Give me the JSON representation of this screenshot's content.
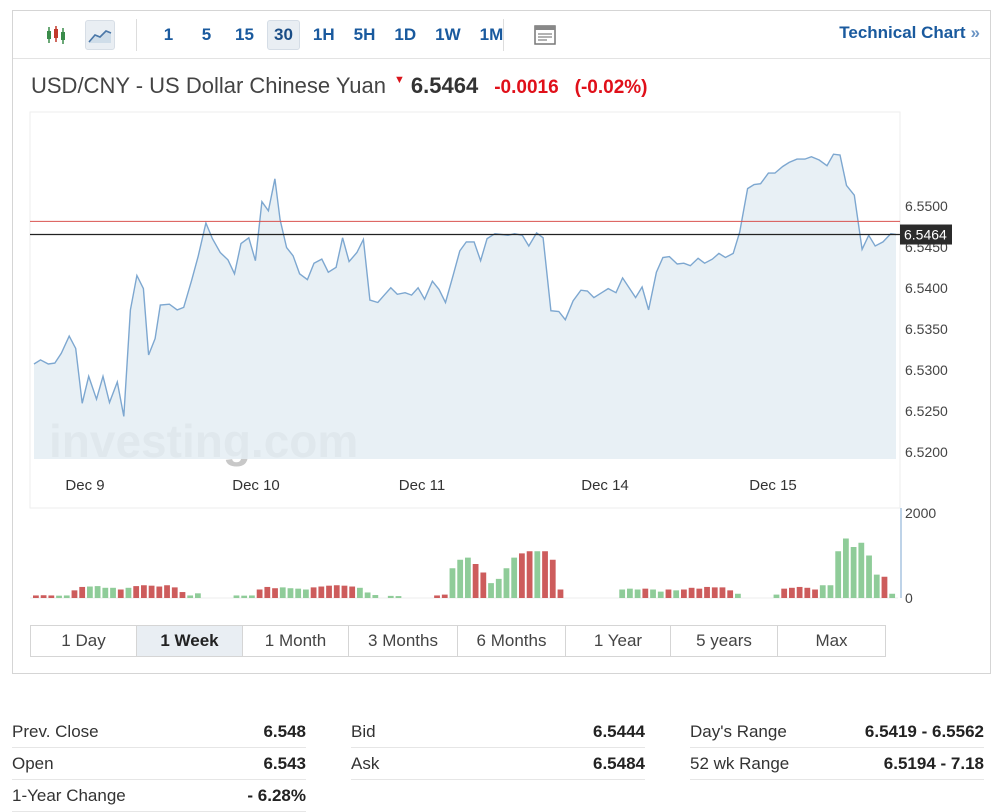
{
  "toolbar": {
    "intervals": [
      {
        "label": "1",
        "active": false
      },
      {
        "label": "5",
        "active": false
      },
      {
        "label": "15",
        "active": false
      },
      {
        "label": "30",
        "active": true
      },
      {
        "label": "1H",
        "active": false
      },
      {
        "label": "5H",
        "active": false
      },
      {
        "label": "1D",
        "active": false
      },
      {
        "label": "1W",
        "active": false
      },
      {
        "label": "1M",
        "active": false
      }
    ],
    "technical_chart_label": "Technical Chart",
    "technical_chart_arrows": "»"
  },
  "header": {
    "name": "USD/CNY - US Dollar Chinese Yuan",
    "price": "6.5464",
    "change": "-0.0016",
    "change_pct": "(-0.02%)"
  },
  "colors": {
    "line": "#7da7d0",
    "area": "#e4edf3",
    "up_bar": "#8fcc99",
    "down_bar": "#cd5c5c",
    "reference_line": "#d9534f",
    "current_line": "#222222",
    "down": "#e0101a",
    "link": "#1a5a9e"
  },
  "watermark": "investing.com",
  "chart_data": {
    "type": "area",
    "ylim": [
      6.519,
      6.5605
    ],
    "y_ticks": [
      "6.5500",
      "6.5450",
      "6.5400",
      "6.5350",
      "6.5300",
      "6.5250",
      "6.5200"
    ],
    "x_labels": [
      "Dec 9",
      "Dec 10",
      "Dec 11",
      "Dec 14",
      "Dec 15"
    ],
    "reference_value": 6.548,
    "current_value": 6.5464,
    "current_label": "6.5464",
    "price_series": [
      [
        0,
        6.5306
      ],
      [
        0.5,
        6.5311
      ],
      [
        1.1,
        6.5306
      ],
      [
        1.6,
        6.5307
      ],
      [
        2.1,
        6.5319
      ],
      [
        2.7,
        6.534
      ],
      [
        3.2,
        6.5325
      ],
      [
        3.7,
        6.5258
      ],
      [
        4.2,
        6.5291
      ],
      [
        4.8,
        6.5263
      ],
      [
        5.3,
        6.5291
      ],
      [
        5.8,
        6.5259
      ],
      [
        6.4,
        6.5284
      ],
      [
        6.9,
        6.5242
      ],
      [
        7.4,
        6.5372
      ],
      [
        7.9,
        6.5414
      ],
      [
        8.4,
        6.5398
      ],
      [
        8.8,
        6.5317
      ],
      [
        9.3,
        6.5337
      ],
      [
        9.7,
        6.5378
      ],
      [
        10.4,
        6.5379
      ],
      [
        11,
        6.5372
      ],
      [
        11.5,
        6.5375
      ],
      [
        12.1,
        6.5408
      ],
      [
        12.6,
        6.5437
      ],
      [
        13.2,
        6.5478
      ],
      [
        13.7,
        6.5459
      ],
      [
        14.3,
        6.5442
      ],
      [
        14.9,
        6.5433
      ],
      [
        15.4,
        6.5416
      ],
      [
        15.9,
        6.5453
      ],
      [
        16.5,
        6.546
      ],
      [
        17,
        6.5432
      ],
      [
        17.5,
        6.5504
      ],
      [
        18,
        6.5493
      ],
      [
        18.5,
        6.5532
      ],
      [
        18.9,
        6.5482
      ],
      [
        19.4,
        6.5448
      ],
      [
        19.9,
        6.5438
      ],
      [
        20.4,
        6.5416
      ],
      [
        21,
        6.5409
      ],
      [
        21.5,
        6.5429
      ],
      [
        22.1,
        6.5434
      ],
      [
        22.6,
        6.5418
      ],
      [
        23.2,
        6.5424
      ],
      [
        23.7,
        6.546
      ],
      [
        24.2,
        6.5431
      ],
      [
        24.8,
        6.5442
      ],
      [
        25.3,
        6.5458
      ],
      [
        25.8,
        6.5384
      ],
      [
        26.4,
        6.5381
      ],
      [
        26.9,
        6.539
      ],
      [
        27.4,
        6.5399
      ],
      [
        27.9,
        6.5391
      ],
      [
        28.5,
        6.5393
      ],
      [
        29,
        6.539
      ],
      [
        29.5,
        6.5399
      ],
      [
        30,
        6.5385
      ],
      [
        30.6,
        6.5407
      ],
      [
        31.1,
        6.5397
      ],
      [
        31.6,
        6.5381
      ],
      [
        32.2,
        6.5415
      ],
      [
        32.7,
        6.5444
      ],
      [
        33.2,
        6.5455
      ],
      [
        33.8,
        6.5455
      ],
      [
        34.3,
        6.5432
      ],
      [
        34.8,
        6.5459
      ],
      [
        35.4,
        6.5465
      ],
      [
        35.9,
        6.5464
      ],
      [
        36.4,
        6.5463
      ],
      [
        36.9,
        6.5465
      ],
      [
        37.5,
        6.5463
      ],
      [
        38,
        6.545
      ],
      [
        38.6,
        6.5466
      ],
      [
        39.1,
        6.546
      ],
      [
        39.7,
        6.5371
      ],
      [
        40.3,
        6.537
      ],
      [
        40.8,
        6.536
      ],
      [
        41.4,
        6.5383
      ],
      [
        42,
        6.5396
      ],
      [
        42.5,
        6.5395
      ],
      [
        43,
        6.5387
      ],
      [
        43.6,
        6.5393
      ],
      [
        44.1,
        6.5398
      ],
      [
        44.7,
        6.5393
      ],
      [
        45.2,
        6.5411
      ],
      [
        45.7,
        6.5399
      ],
      [
        46.2,
        6.5387
      ],
      [
        46.7,
        6.54
      ],
      [
        47.2,
        6.5372
      ],
      [
        47.8,
        6.5418
      ],
      [
        48.3,
        6.5436
      ],
      [
        48.8,
        6.5437
      ],
      [
        49.4,
        6.5428
      ],
      [
        49.9,
        6.5429
      ],
      [
        50.4,
        6.5426
      ],
      [
        51,
        6.5435
      ],
      [
        51.5,
        6.5429
      ],
      [
        52.1,
        6.5434
      ],
      [
        52.6,
        6.5441
      ],
      [
        53.1,
        6.5436
      ],
      [
        53.7,
        6.5441
      ],
      [
        54.2,
        6.5467
      ],
      [
        54.8,
        6.552
      ],
      [
        55.3,
        6.5525
      ],
      [
        55.8,
        6.5526
      ],
      [
        56.4,
        6.5539
      ],
      [
        56.9,
        6.5539
      ],
      [
        57.5,
        6.5547
      ],
      [
        58,
        6.5552
      ],
      [
        58.6,
        6.5556
      ],
      [
        59.2,
        6.5556
      ],
      [
        59.7,
        6.5559
      ],
      [
        60.3,
        6.5555
      ],
      [
        60.9,
        6.5548
      ],
      [
        61.4,
        6.5562
      ],
      [
        61.9,
        6.5561
      ],
      [
        62.4,
        6.5524
      ],
      [
        63,
        6.5512
      ],
      [
        63.6,
        6.5446
      ],
      [
        64.1,
        6.5463
      ],
      [
        64.6,
        6.545
      ],
      [
        65.2,
        6.5455
      ],
      [
        65.8,
        6.5465
      ],
      [
        66.2,
        6.5464
      ]
    ],
    "volume_axis": {
      "ylim": [
        0,
        2000
      ],
      "ticks": [
        "2000",
        "0"
      ]
    },
    "volume": [
      [
        0,
        60,
        0
      ],
      [
        1,
        65,
        0
      ],
      [
        2,
        60,
        0
      ],
      [
        3,
        55,
        1
      ],
      [
        4,
        60,
        1
      ],
      [
        5,
        180,
        0
      ],
      [
        6,
        260,
        0
      ],
      [
        7,
        270,
        1
      ],
      [
        8,
        280,
        1
      ],
      [
        9,
        240,
        1
      ],
      [
        10,
        240,
        1
      ],
      [
        11,
        200,
        0
      ],
      [
        12,
        240,
        1
      ],
      [
        13,
        280,
        0
      ],
      [
        14,
        300,
        0
      ],
      [
        15,
        290,
        0
      ],
      [
        16,
        270,
        0
      ],
      [
        17,
        300,
        0
      ],
      [
        18,
        250,
        0
      ],
      [
        19,
        140,
        0
      ],
      [
        20,
        60,
        1
      ],
      [
        21,
        110,
        1
      ],
      [
        26,
        60,
        1
      ],
      [
        27,
        55,
        1
      ],
      [
        28,
        60,
        1
      ],
      [
        29,
        200,
        0
      ],
      [
        30,
        260,
        0
      ],
      [
        31,
        230,
        0
      ],
      [
        32,
        250,
        1
      ],
      [
        33,
        230,
        1
      ],
      [
        34,
        220,
        1
      ],
      [
        35,
        200,
        1
      ],
      [
        36,
        250,
        0
      ],
      [
        37,
        270,
        0
      ],
      [
        38,
        290,
        0
      ],
      [
        39,
        300,
        0
      ],
      [
        40,
        290,
        0
      ],
      [
        41,
        270,
        0
      ],
      [
        42,
        240,
        1
      ],
      [
        43,
        130,
        1
      ],
      [
        44,
        70,
        1
      ],
      [
        46,
        50,
        1
      ],
      [
        47,
        45,
        1
      ],
      [
        52,
        60,
        0
      ],
      [
        53,
        80,
        0
      ],
      [
        54,
        700,
        1
      ],
      [
        55,
        900,
        1
      ],
      [
        56,
        950,
        1
      ],
      [
        57,
        800,
        0
      ],
      [
        58,
        600,
        0
      ],
      [
        59,
        350,
        1
      ],
      [
        60,
        450,
        1
      ],
      [
        61,
        700,
        1
      ],
      [
        62,
        950,
        1
      ],
      [
        63,
        1050,
        0
      ],
      [
        64,
        1100,
        0
      ],
      [
        65,
        1100,
        1
      ],
      [
        66,
        1100,
        0
      ],
      [
        67,
        900,
        0
      ],
      [
        68,
        200,
        0
      ],
      [
        76,
        200,
        1
      ],
      [
        77,
        220,
        1
      ],
      [
        78,
        200,
        1
      ],
      [
        79,
        220,
        0
      ],
      [
        80,
        200,
        1
      ],
      [
        81,
        150,
        1
      ],
      [
        82,
        200,
        0
      ],
      [
        83,
        180,
        1
      ],
      [
        84,
        200,
        0
      ],
      [
        85,
        240,
        0
      ],
      [
        86,
        220,
        0
      ],
      [
        87,
        260,
        0
      ],
      [
        88,
        250,
        0
      ],
      [
        89,
        250,
        0
      ],
      [
        90,
        180,
        0
      ],
      [
        91,
        100,
        1
      ],
      [
        96,
        80,
        1
      ],
      [
        97,
        220,
        0
      ],
      [
        98,
        240,
        0
      ],
      [
        99,
        260,
        0
      ],
      [
        100,
        240,
        0
      ],
      [
        101,
        200,
        0
      ],
      [
        102,
        300,
        1
      ],
      [
        103,
        300,
        1
      ],
      [
        104,
        1100,
        1
      ],
      [
        105,
        1400,
        1
      ],
      [
        106,
        1200,
        1
      ],
      [
        107,
        1300,
        1
      ],
      [
        108,
        1000,
        1
      ],
      [
        109,
        550,
        1
      ],
      [
        110,
        500,
        0
      ],
      [
        111,
        100,
        1
      ]
    ]
  },
  "ranges": [
    {
      "label": "1 Day",
      "active": false
    },
    {
      "label": "1 Week",
      "active": true
    },
    {
      "label": "1 Month",
      "active": false
    },
    {
      "label": "3 Months",
      "active": false
    },
    {
      "label": "6 Months",
      "active": false
    },
    {
      "label": "1 Year",
      "active": false
    },
    {
      "label": "5 years",
      "active": false
    },
    {
      "label": "Max",
      "active": false
    }
  ],
  "stats": {
    "col1": [
      {
        "label": "Prev. Close",
        "value": "6.548"
      },
      {
        "label": "Open",
        "value": "6.543"
      },
      {
        "label": "1-Year Change",
        "value": "- 6.28%"
      }
    ],
    "col2": [
      {
        "label": "Bid",
        "value": "6.5444"
      },
      {
        "label": "Ask",
        "value": "6.5484"
      }
    ],
    "col3": [
      {
        "label": "Day's Range",
        "value": "6.5419 - 6.5562"
      },
      {
        "label": "52 wk Range",
        "value": "6.5194 - 7.18"
      }
    ]
  }
}
